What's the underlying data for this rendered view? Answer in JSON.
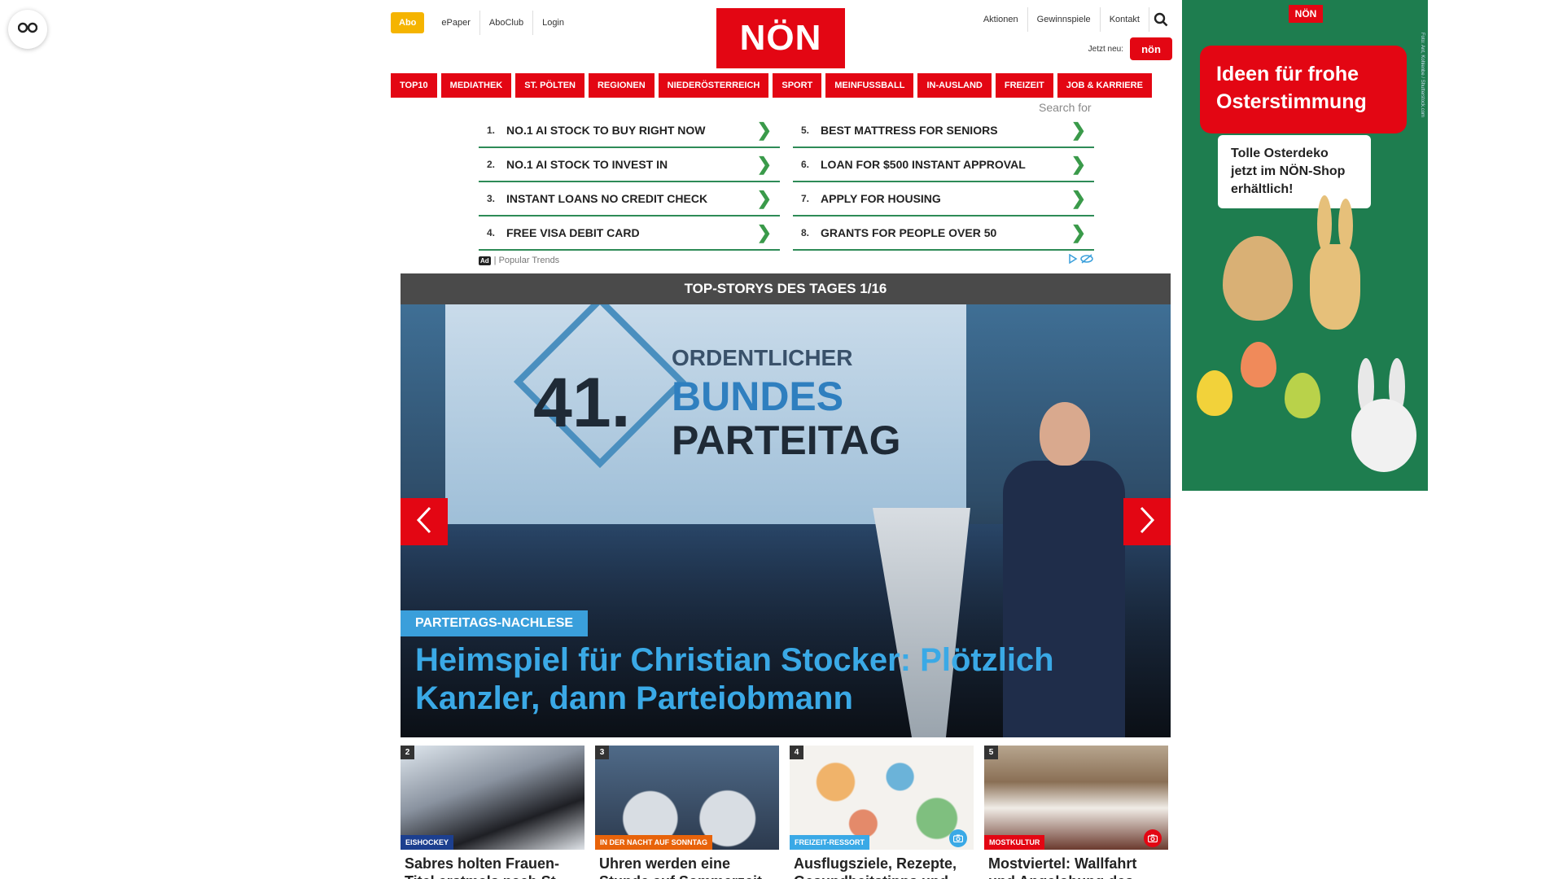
{
  "accessibility": {
    "icon": "glasses-icon"
  },
  "header": {
    "top_left_links": [
      "Abo",
      "ePaper",
      "AboClub",
      "Login"
    ],
    "logo_text": "NÖN",
    "top_right_links": [
      "Aktionen",
      "Gewinnspiele",
      "Kontakt"
    ],
    "search_icon": "search-icon",
    "jetzt_neu_label": "Jetzt neu:",
    "jetzt_neu_badge": "nön"
  },
  "nav": {
    "items": [
      "TOP10",
      "MEDIATHEK",
      "ST. PÖLTEN",
      "REGIONEN",
      "NIEDERÖSTERREICH",
      "SPORT",
      "MEINFUSSBALL",
      "IN-AUSLAND",
      "FREIZEIT",
      "JOB & KARRIERE"
    ]
  },
  "search_ads": {
    "search_for_label": "Search for",
    "items": [
      {
        "num": "1.",
        "text": "NO.1 AI STOCK TO BUY RIGHT NOW"
      },
      {
        "num": "5.",
        "text": "BEST MATTRESS FOR SENIORS"
      },
      {
        "num": "2.",
        "text": "NO.1 AI STOCK TO INVEST IN"
      },
      {
        "num": "6.",
        "text": "LOAN FOR $500 INSTANT APPROVAL"
      },
      {
        "num": "3.",
        "text": "INSTANT LOANS NO CREDIT CHECK"
      },
      {
        "num": "7.",
        "text": "APPLY FOR HOUSING"
      },
      {
        "num": "4.",
        "text": "FREE VISA DEBIT CARD"
      },
      {
        "num": "8.",
        "text": "GRANTS FOR PEOPLE OVER 50"
      }
    ],
    "chevron": "❯",
    "ad_mark": "Ad",
    "footer_label": "| Popular Trends"
  },
  "top_stories": {
    "bar_title": "TOP-STORYS DES TAGES 1/16",
    "hero": {
      "screen_number": "41.",
      "screen_line1": "ORDENTLICHER",
      "screen_line2": "BUNDES",
      "screen_line3": "PARTEITAG",
      "kicker": "PARTEITAGS-NACHLESE",
      "title": "Heimspiel für Christian Stocker: Plötzlich Kanzler, dann Parteiobmann"
    },
    "teasers": [
      {
        "num": "2",
        "tag": "EISHOCKEY",
        "tag_color": "#1c3f8f",
        "title": "Sabres holten Frauen-Titel erstmals nach St. Pölten",
        "has_camera": false,
        "img_color": "#2b2f36"
      },
      {
        "num": "3",
        "tag": "IN DER NACHT AUF SONNTAG",
        "tag_color": "#e8630a",
        "title": "Uhren werden eine Stunde auf Sommerzeit umgestellt",
        "has_camera": false,
        "img_color": "#3c4a5e"
      },
      {
        "num": "4",
        "tag": "FREIZEIT-RESSORT",
        "tag_color": "#3aa9e6",
        "title": "Ausflugsziele, Rezepte, Gesundheitstipps und mehr",
        "has_camera": true,
        "img_color": "#e9ecef"
      },
      {
        "num": "5",
        "tag": "MOSTKULTUR",
        "tag_color": "#e30613",
        "title": "Mostviertel: Wallfahrt und Angelobung des Mostadels",
        "has_camera": true,
        "img_color": "#6b5848"
      }
    ]
  },
  "side_ad": {
    "logo": "NÖN",
    "headline": "Ideen für frohe Osterstimmung",
    "body": "Tolle Osterdeko jetzt im NÖN-Shop erhältlich!",
    "credit": "Foto: Ant, Kohlenbe / Shutterstock.com"
  }
}
